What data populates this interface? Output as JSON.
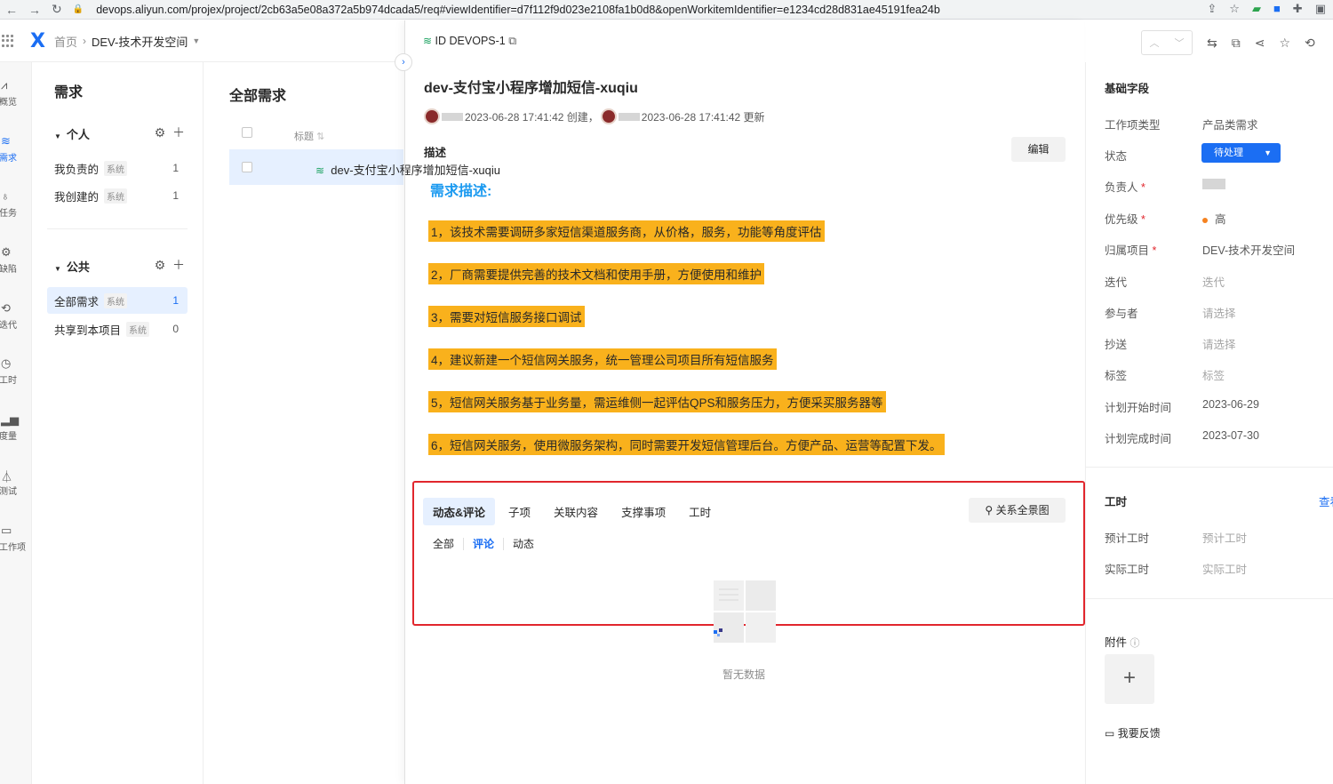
{
  "browser": {
    "url": "devops.aliyun.com/projex/project/2cb63a5e08a372a5b974dcada5/req#viewIdentifier=d7f112f9d023e2108fa1b0d8&openWorkitemIdentifier=e1234cd28d831ae45191fea24b"
  },
  "header": {
    "crumb_home": "首页",
    "crumb_space": "DEV-技术开发空间"
  },
  "leftnav": {
    "items": [
      {
        "label": "概览"
      },
      {
        "label": "需求"
      },
      {
        "label": "任务"
      },
      {
        "label": "缺陷"
      },
      {
        "label": "迭代"
      },
      {
        "label": "工时"
      },
      {
        "label": "度量"
      },
      {
        "label": "测试"
      },
      {
        "label": "工作项"
      }
    ]
  },
  "sidebar": {
    "title": "需求",
    "personal_label": "个人",
    "public_label": "公共",
    "system_tag": "系统",
    "items": [
      {
        "label": "我负责的",
        "count": "1"
      },
      {
        "label": "我创建的",
        "count": "1"
      },
      {
        "label": "全部需求",
        "count": "1"
      },
      {
        "label": "共享到本项目",
        "count": "0"
      }
    ]
  },
  "list": {
    "title": "全部需求",
    "col_title": "标题",
    "row_title": "dev-支付宝小程序增加短信-xuqiu"
  },
  "detail": {
    "id_label": "ID DEVOPS-1",
    "title": "dev-支付宝小程序增加短信-xuqiu",
    "created": "2023-06-28 17:41:42 创建，",
    "updated": "2023-06-28 17:41:42 更新",
    "desc_label": "描述",
    "edit_label": "编辑",
    "req_heading": "需求描述:",
    "lines": [
      "1，该技术需要调研多家短信渠道服务商，从价格，服务，功能等角度评估",
      "2，厂商需要提供完善的技术文档和使用手册，方便使用和维护",
      "3，需要对短信服务接口调试",
      "4，建议新建一个短信网关服务，统一管理公司项目所有短信服务",
      "5，短信网关服务基于业务量，需运维侧一起评估QPS和服务压力，方便采买服务器等",
      "6，短信网关服务，使用微服务架构，同时需要开发短信管理后台。方便产品、运营等配置下发。"
    ],
    "tabs": [
      "动态&评论",
      "子项",
      "关联内容",
      "支撑事项",
      "工时"
    ],
    "relation_btn": "关系全景图",
    "subtabs": [
      "全部",
      "评论",
      "动态"
    ],
    "empty_text": "暂无数据"
  },
  "fields": {
    "basic_title": "基础字段",
    "rows": [
      {
        "label": "工作项类型",
        "value": "产品类需求"
      },
      {
        "label": "状态",
        "value": "待处理"
      },
      {
        "label": "负责人",
        "value": ""
      },
      {
        "label": "优先级",
        "value": "高"
      },
      {
        "label": "归属项目",
        "value": "DEV-技术开发空间"
      },
      {
        "label": "迭代",
        "value": "迭代"
      },
      {
        "label": "参与者",
        "value": "请选择"
      },
      {
        "label": "抄送",
        "value": "请选择"
      },
      {
        "label": "标签",
        "value": "标签"
      },
      {
        "label": "计划开始时间",
        "value": "2023-06-29"
      },
      {
        "label": "计划完成时间",
        "value": "2023-07-30"
      }
    ],
    "worktime_title": "工时",
    "worktime_link": "查看",
    "planned_label": "预计工时",
    "planned_value": "预计工时",
    "actual_label": "实际工时",
    "actual_value": "实际工时",
    "attach_title": "附件",
    "feedback": "我要反馈"
  },
  "colors": {
    "accent": "#1b6ef3",
    "highlight": "#f9b11c",
    "redbox": "#e1262d"
  }
}
